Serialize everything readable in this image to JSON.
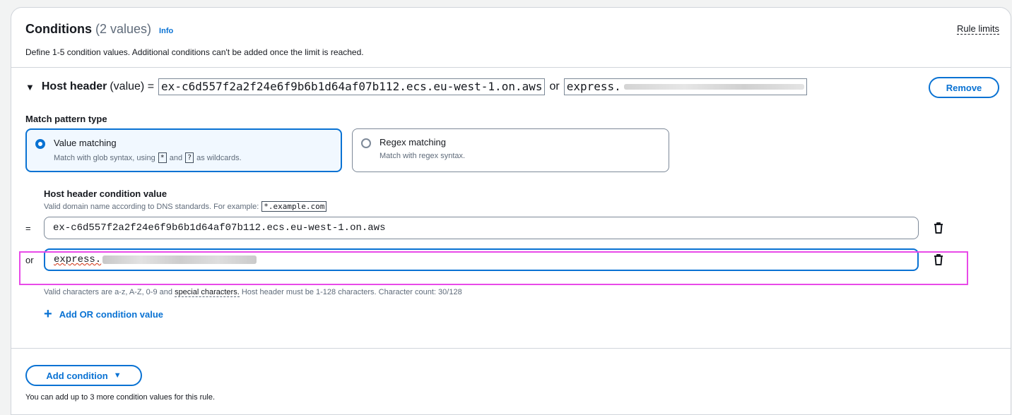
{
  "header": {
    "title": "Conditions",
    "count": "(2 values)",
    "info": "Info",
    "rule_limits": "Rule limits",
    "description": "Define 1-5 condition values. Additional conditions can't be added once the limit is reached."
  },
  "condition": {
    "caret_icon": "caret-down-icon",
    "label": "Host header",
    "qualifier": "(value) =",
    "value1": "ex-c6d557f2a2f24e6f9b6b1d64af07b112.ecs.eu-west-1.on.aws",
    "or": "or",
    "value2_visible": "express.",
    "remove": "Remove"
  },
  "match_pattern": {
    "label": "Match pattern type",
    "options": [
      {
        "title": "Value matching",
        "desc_before": "Match with glob syntax, using",
        "wildcard1": "*",
        "and": "and",
        "wildcard2": "?",
        "desc_after": "as wildcards.",
        "selected": true
      },
      {
        "title": "Regex matching",
        "desc": "Match with regex syntax.",
        "selected": false
      }
    ]
  },
  "host_value": {
    "label": "Host header condition value",
    "desc": "Valid domain name according to DNS standards. For example:",
    "example": "*.example.com",
    "rows": [
      {
        "prefix": "=",
        "value": "ex-c6d557f2a2f24e6f9b6b1d64af07b112.ecs.eu-west-1.on.aws"
      },
      {
        "prefix": "or",
        "value": "express."
      }
    ],
    "constraint_before": "Valid characters are a-z, A-Z, 0-9 and",
    "constraint_link": "special characters.",
    "constraint_after": "Host header must be 1-128 characters. Character count: 30/128",
    "add_or": "Add OR condition value"
  },
  "footer": {
    "add_condition": "Add condition",
    "note": "You can add up to 3 more condition values for this rule."
  },
  "colors": {
    "accent": "#0972d3",
    "highlight": "#e84ae8",
    "error_underline": "#d13212"
  }
}
